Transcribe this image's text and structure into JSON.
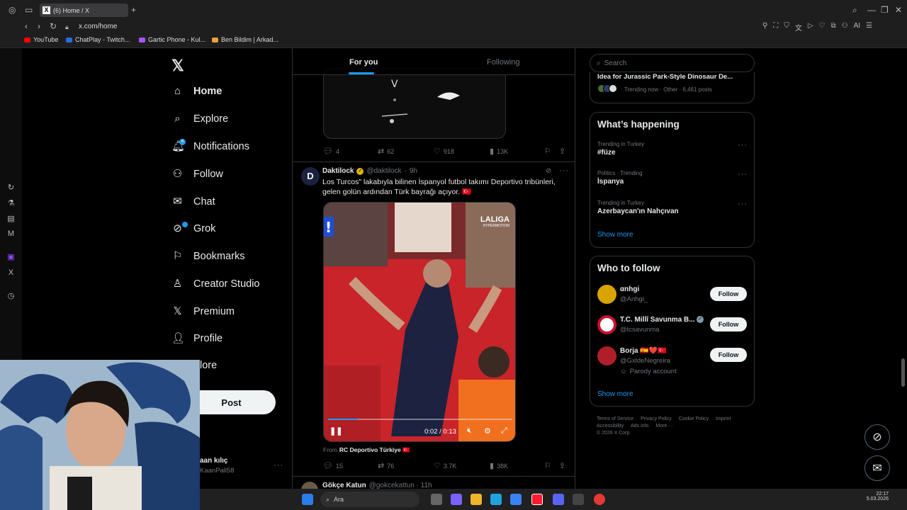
{
  "browser": {
    "tab_title": "(6) Home / X",
    "url": "x.com/home",
    "bookmarks": [
      {
        "label": "YouTube",
        "color": "#ff0000"
      },
      {
        "label": "ChatPlay - Twitch...",
        "color": "#2b6de0"
      },
      {
        "label": "Gartic Phone - Kul...",
        "color": "#a855f7"
      },
      {
        "label": "Ben Bildim | Arkad...",
        "color": "#f2a03d"
      }
    ],
    "ai_label": "AI"
  },
  "sidebar": {
    "logo": "𝕏",
    "items": [
      {
        "label": "Home",
        "icon": "house-icon"
      },
      {
        "label": "Explore",
        "icon": "search-icon"
      },
      {
        "label": "Notifications",
        "icon": "bell-icon",
        "badge": "6"
      },
      {
        "label": "Follow",
        "icon": "person-add-icon"
      },
      {
        "label": "Chat",
        "icon": "mail-icon"
      },
      {
        "label": "Grok",
        "icon": "grok-icon"
      },
      {
        "label": "Bookmarks",
        "icon": "bookmark-icon"
      },
      {
        "label": "Creator Studio",
        "icon": "creator-icon"
      },
      {
        "label": "Premium",
        "icon": "x-icon"
      },
      {
        "label": "Profile",
        "icon": "person-icon"
      },
      {
        "label": "More",
        "icon": "more-circle-icon"
      }
    ],
    "more_visible": "lore",
    "post_label": "Post",
    "account_name": "aan kılıç",
    "account_handle": "KaanPall58"
  },
  "feed": {
    "tabs": [
      "For you",
      "Following"
    ],
    "prev_tweet_stats": {
      "replies": "4",
      "reposts": "62",
      "likes": "918",
      "views": "13K"
    },
    "tweet": {
      "author": "Daktilock",
      "handle": "@daktilock",
      "time": "9h",
      "text_line1": "Los Turcos\" lakabıyla bilinen İspanyol futbol takımı Deportivo tribünleri,",
      "text_line2": "gelen golün ardından Türk bayrağı açıyor. 🇹🇷",
      "video_time": "0:02 / 0:13",
      "video_progress": 0.16,
      "laliga": "LALIGA",
      "laliga_sub": "HYPERMOTION",
      "from_prefix": "From",
      "from_account": "RC Deportivo Türkiye 🇹🇷",
      "stats": {
        "replies": "15",
        "reposts": "76",
        "likes": "3.7K",
        "views": "38K"
      }
    },
    "next_author": "Gökçe Katun",
    "next_handle": "@gokcekattun · 11h"
  },
  "right": {
    "search_placeholder": "Search",
    "top_trend": {
      "title": "Idea for Jurassic Park-Style Dinosaur De...",
      "meta": "Trending now · Other · 6,461 posts"
    },
    "happening_title": "What’s happening",
    "trends": [
      {
        "context": "Trending in Turkey",
        "name": "#füze"
      },
      {
        "context": "Politics · Trending",
        "name": "İspanya"
      },
      {
        "context": "Trending in Turkey",
        "name": "Azerbaycan'ın Nahçıvan"
      }
    ],
    "show_more": "Show more",
    "who_title": "Who to follow",
    "follow_label": "Follow",
    "suggestions": [
      {
        "name": "αnhgi",
        "handle": "@Anhgi_",
        "color": "#d9a300"
      },
      {
        "name": "T.C. Millî Savunma B...",
        "handle": "@tcsavunma",
        "color": "#c8102e"
      },
      {
        "name": "Borja 🇪🇸❤️🇹🇷",
        "handle": "@GxldeNegreira",
        "note": "Parody account",
        "color": "#b01e2a"
      }
    ],
    "footer": [
      "Terms of Service",
      "Privacy Policy",
      "Cookie Policy",
      "Imprint",
      "Accessibility",
      "Ads info",
      "More ···",
      "© 2026 X Corp."
    ]
  },
  "taskbar": {
    "search_label": "Ara",
    "time": "22:17",
    "date": "5.03.2026"
  }
}
